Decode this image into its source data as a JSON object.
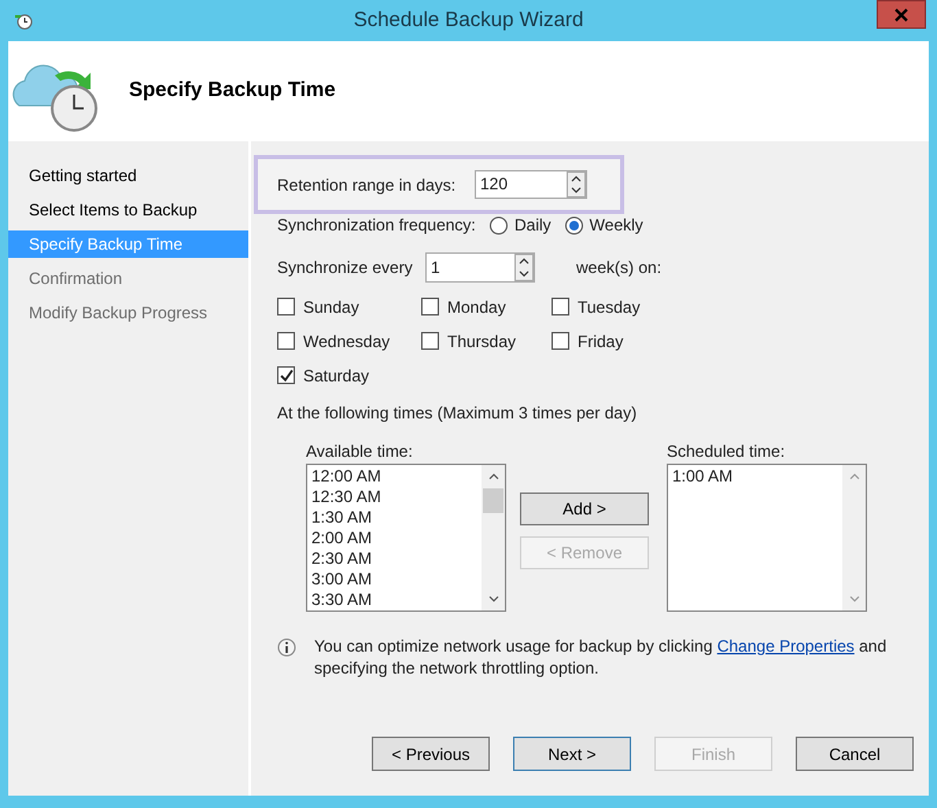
{
  "window": {
    "title": "Schedule Backup Wizard"
  },
  "header": {
    "title": "Specify Backup Time"
  },
  "steps": [
    {
      "label": "Getting started",
      "selected": false,
      "enabled": true
    },
    {
      "label": "Select Items to Backup",
      "selected": false,
      "enabled": true
    },
    {
      "label": "Specify Backup Time",
      "selected": true,
      "enabled": true
    },
    {
      "label": "Confirmation",
      "selected": false,
      "enabled": false
    },
    {
      "label": "Modify Backup Progress",
      "selected": false,
      "enabled": false
    }
  ],
  "retention": {
    "label": "Retention range in days:",
    "value": "120"
  },
  "frequency": {
    "label": "Synchronization frequency:",
    "options": [
      {
        "label": "Daily",
        "selected": false
      },
      {
        "label": "Weekly",
        "selected": true
      }
    ]
  },
  "every": {
    "label": "Synchronize every",
    "value": "1",
    "suffix": "week(s) on:"
  },
  "days": [
    {
      "label": "Sunday",
      "checked": false
    },
    {
      "label": "Monday",
      "checked": false
    },
    {
      "label": "Tuesday",
      "checked": false
    },
    {
      "label": "Wednesday",
      "checked": false
    },
    {
      "label": "Thursday",
      "checked": false
    },
    {
      "label": "Friday",
      "checked": false
    },
    {
      "label": "Saturday",
      "checked": true
    }
  ],
  "times_label": "At the following times (Maximum 3 times per day)",
  "available": {
    "label": "Available time:",
    "items": [
      "12:00 AM",
      "12:30 AM",
      "1:30 AM",
      "2:00 AM",
      "2:30 AM",
      "3:00 AM",
      "3:30 AM"
    ]
  },
  "add_button": {
    "label": "Add >",
    "disabled": false
  },
  "remove_button": {
    "label": "< Remove",
    "disabled": true
  },
  "scheduled": {
    "label": "Scheduled time:",
    "items": [
      "1:00 AM"
    ]
  },
  "info": {
    "before": "You can optimize network usage for backup by clicking",
    "link": "Change Properties",
    "after": "and specifying the network throttling option."
  },
  "buttons": [
    {
      "label": "< Previous",
      "disabled": false,
      "default": false
    },
    {
      "label": "Next >",
      "disabled": false,
      "default": true
    },
    {
      "label": "Finish",
      "disabled": true,
      "default": false
    },
    {
      "label": "Cancel",
      "disabled": false,
      "default": false
    }
  ]
}
